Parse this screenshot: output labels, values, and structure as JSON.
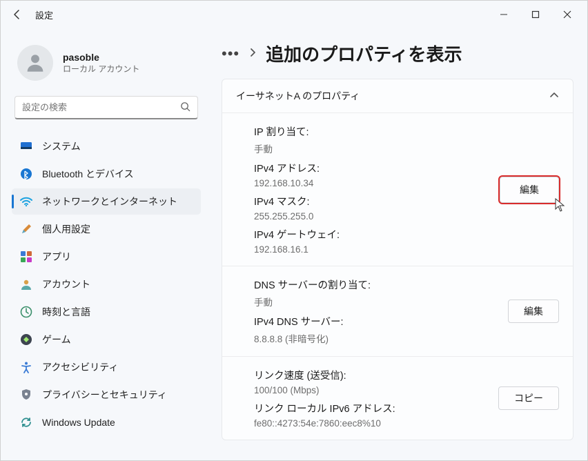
{
  "window": {
    "title": "設定"
  },
  "user": {
    "name": "pasoble",
    "sub": "ローカル アカウント"
  },
  "search": {
    "placeholder": "設定の検索"
  },
  "nav": {
    "items": [
      {
        "label": "システム"
      },
      {
        "label": "Bluetooth とデバイス"
      },
      {
        "label": "ネットワークとインターネット"
      },
      {
        "label": "個人用設定"
      },
      {
        "label": "アプリ"
      },
      {
        "label": "アカウント"
      },
      {
        "label": "時刻と言語"
      },
      {
        "label": "ゲーム"
      },
      {
        "label": "アクセシビリティ"
      },
      {
        "label": "プライバシーとセキュリティ"
      },
      {
        "label": "Windows Update"
      }
    ]
  },
  "page": {
    "title": "追加のプロパティを表示"
  },
  "section": {
    "title": "イーサネットA のプロパティ"
  },
  "ip": {
    "assign_label": "IP 割り当て:",
    "assign_value": "手動",
    "v4addr_label": "IPv4 アドレス:",
    "v4addr_value": "192.168.10.34",
    "v4mask_label": "IPv4 マスク:",
    "v4mask_value": "255.255.255.0",
    "v4gw_label": "IPv4 ゲートウェイ:",
    "v4gw_value": "192.168.16.1",
    "edit_label": "編集"
  },
  "dns": {
    "assign_label": "DNS サーバーの割り当て:",
    "assign_value": "手動",
    "v4dns_label": "IPv4 DNS サーバー:",
    "v4dns_value": "8.8.8.8 (非暗号化)",
    "edit_label": "編集"
  },
  "link": {
    "speed_label": "リンク速度 (送受信):",
    "speed_value": "100/100 (Mbps)",
    "v6local_label": "リンク ローカル IPv6 アドレス:",
    "v6local_value": "fe80::4273:54e:7860:eec8%10",
    "copy_label": "コピー"
  }
}
